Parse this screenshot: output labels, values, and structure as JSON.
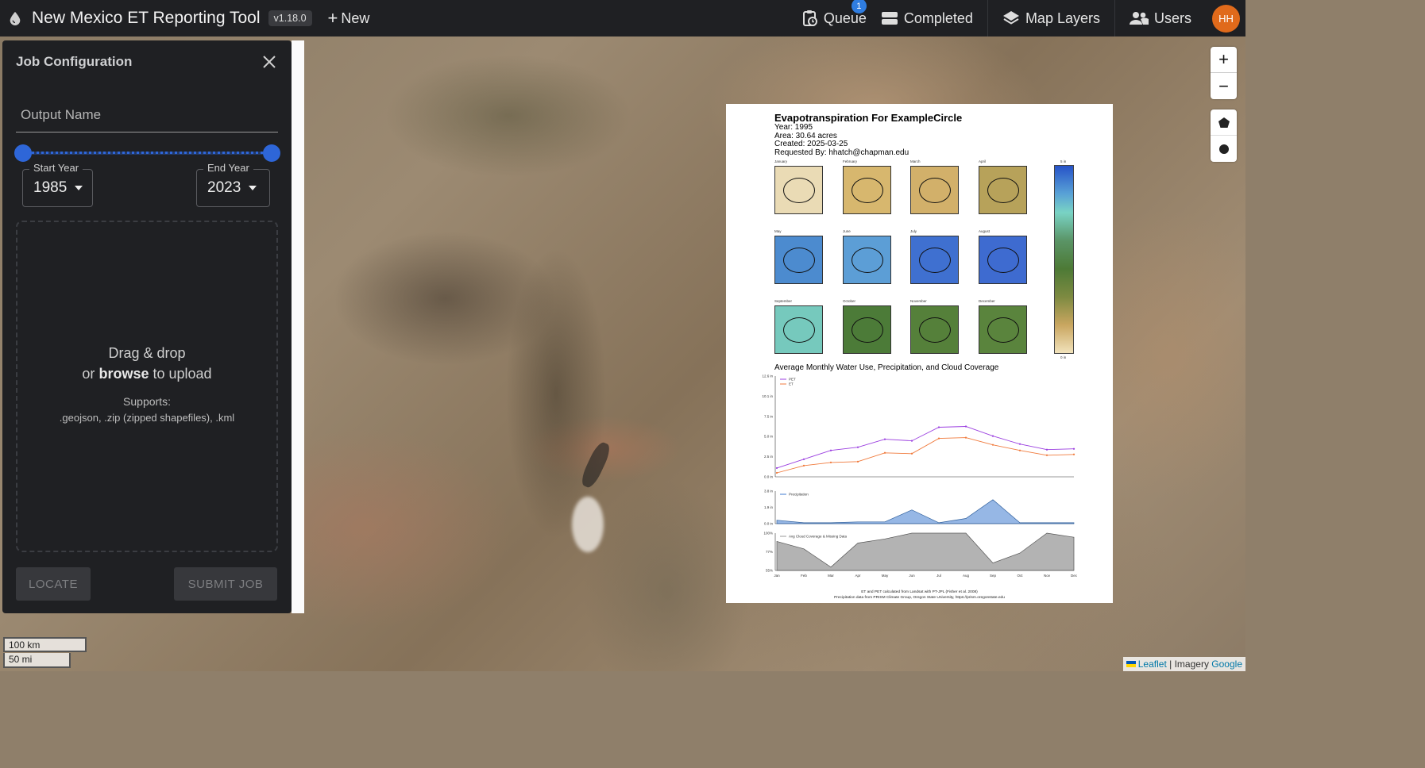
{
  "header": {
    "app_title": "New Mexico ET Reporting Tool",
    "version": "v1.18.0",
    "new_label": "New",
    "nav": {
      "queue": "Queue",
      "queue_badge": "1",
      "completed": "Completed",
      "map_layers": "Map Layers",
      "users": "Users",
      "avatar_initials": "HH"
    }
  },
  "sidebar": {
    "title": "Job Configuration",
    "output_name_placeholder": "Output Name",
    "year_range": {
      "min": 1985,
      "max": 2023
    },
    "start_year_label": "Start Year",
    "start_year": "1985",
    "end_year_label": "End Year",
    "end_year": "2023",
    "dropzone": {
      "line1": "Drag & drop",
      "line2_prefix": "or",
      "line2_bold": "browse",
      "line2_suffix": "to upload",
      "supports_label": "Supports:",
      "types": ".geojson, .zip (zipped shapefiles), .kml"
    },
    "locate_label": "LOCATE",
    "submit_label": "SUBMIT JOB"
  },
  "map": {
    "zoom_in": "+",
    "zoom_out": "−",
    "scale_km": "100 km",
    "scale_mi": "50 mi",
    "attribution": {
      "leaflet": "Leaflet",
      "sep": "|",
      "imagery": "Imagery",
      "provider": "Google"
    }
  },
  "report": {
    "title": "Evapotranspiration For ExampleCircle",
    "year": "Year: 1995",
    "area": "Area: 30.64 acres",
    "created": "Created: 2025-03-25",
    "requested_by": "Requested By: hhatch@chapman.edu",
    "months": [
      {
        "name": "January",
        "color": "#eadbb5",
        "ring": true
      },
      {
        "name": "February",
        "color": "#d7b76e",
        "ring": true
      },
      {
        "name": "March",
        "color": "#d2b06a",
        "ring": true
      },
      {
        "name": "April",
        "color": "#b7a25a",
        "ring": true
      },
      {
        "name": "May",
        "color": "#4c8bcf",
        "ring": true
      },
      {
        "name": "June",
        "color": "#5c9ed6",
        "ring": true
      },
      {
        "name": "July",
        "color": "#3f70d0",
        "ring": true
      },
      {
        "name": "August",
        "color": "#3e6bd0",
        "ring": true
      },
      {
        "name": "September",
        "color": "#76c9bd",
        "ring": true
      },
      {
        "name": "October",
        "color": "#4c7b38",
        "ring": true
      },
      {
        "name": "November",
        "color": "#55803a",
        "ring": true
      },
      {
        "name": "December",
        "color": "#5a843d",
        "ring": true
      }
    ],
    "colorbar_top": "5 in",
    "colorbar_bottom": "0 in",
    "chart_title": "Average Monthly Water Use, Precipitation, and Cloud Coverage",
    "footer1": "ET and PET calculated from Landsat with PT-JPL (Fisher et al. 2008)",
    "footer2": "Precipitation data from PRISM Climate Group, Oregon State University, https://prism.oregonstate.edu"
  },
  "chart_data": [
    {
      "type": "line",
      "x": [
        "Jan",
        "Feb",
        "Mar",
        "Apr",
        "May",
        "Jun",
        "Jul",
        "Aug",
        "Sep",
        "Oct",
        "Nov",
        "Dec"
      ],
      "series": [
        {
          "name": "PET",
          "color": "#9b3fe0",
          "values": [
            1.1,
            2.2,
            3.3,
            3.7,
            4.7,
            4.5,
            6.2,
            6.3,
            5.1,
            4.1,
            3.4,
            3.5
          ]
        },
        {
          "name": "ET",
          "color": "#f07a3c",
          "values": [
            0.5,
            1.4,
            1.8,
            1.9,
            3.0,
            2.9,
            4.8,
            4.9,
            4.0,
            3.3,
            2.7,
            2.8
          ]
        }
      ],
      "yticks": [
        "0.0 in",
        "2.5 in",
        "5.0 in",
        "7.5 in",
        "10.1 in",
        "12.6 in"
      ],
      "ylim": [
        0,
        12.6
      ]
    },
    {
      "type": "area",
      "x": [
        "Jan",
        "Feb",
        "Mar",
        "Apr",
        "May",
        "Jun",
        "Jul",
        "Aug",
        "Sep",
        "Oct",
        "Nov",
        "Dec"
      ],
      "series": [
        {
          "name": "Precipitation",
          "color": "#3f7bd0",
          "values": [
            0.4,
            0.1,
            0.1,
            0.2,
            0.2,
            1.6,
            0.1,
            0.6,
            2.8,
            0.1,
            0.1,
            0.1
          ]
        }
      ],
      "yticks": [
        "0.0 in",
        "1.9 in",
        "3.8 in"
      ],
      "ylim": [
        0,
        3.8
      ]
    },
    {
      "type": "area",
      "x": [
        "Jan",
        "Feb",
        "Mar",
        "Apr",
        "May",
        "Jun",
        "Jul",
        "Aug",
        "Sep",
        "Oct",
        "Nov",
        "Dec"
      ],
      "series": [
        {
          "name": "Avg Cloud Coverage & Missing Data",
          "color": "#999999",
          "values": [
            90,
            81,
            59,
            88,
            93,
            100,
            100,
            100,
            64,
            76,
            100,
            95
          ]
        }
      ],
      "yticks": [
        "55%",
        "77%",
        "100%"
      ],
      "ylim": [
        55,
        100
      ]
    }
  ]
}
